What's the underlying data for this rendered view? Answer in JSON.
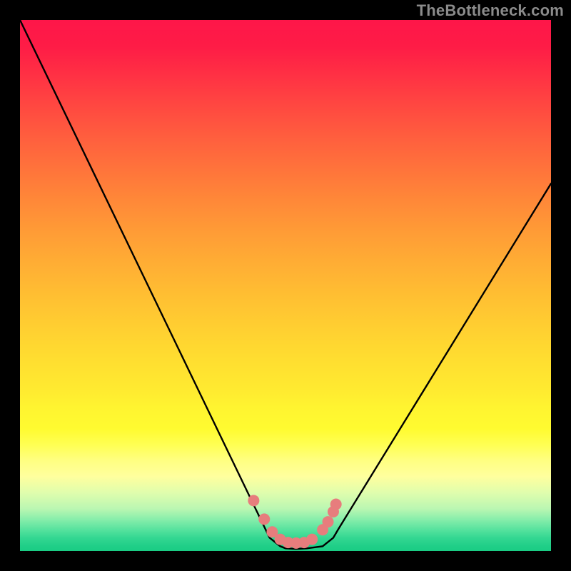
{
  "watermark": "TheBottleneck.com",
  "chart_data": {
    "type": "line",
    "title": "",
    "xlabel": "",
    "ylabel": "",
    "xlim": [
      0,
      100
    ],
    "ylim": [
      0,
      100
    ],
    "grid": false,
    "series": [
      {
        "name": "bottleneck-curve",
        "stroke": "#000000",
        "x": [
          0,
          4,
          8,
          12,
          16,
          20,
          24,
          28,
          32,
          36,
          40,
          44,
          47,
          49,
          50,
          52,
          54,
          57,
          59,
          60,
          64,
          68,
          72,
          76,
          80,
          84,
          88,
          92,
          96,
          100
        ],
        "values": [
          100,
          91.7,
          83.4,
          75.1,
          66.8,
          58.5,
          50.2,
          41.9,
          33.6,
          25.3,
          17,
          8.7,
          2.5,
          0.9,
          0.5,
          0.4,
          0.5,
          0.9,
          2.5,
          4.2,
          10.7,
          17.2,
          23.7,
          30.2,
          36.7,
          43.2,
          49.7,
          56.2,
          62.7,
          69.2
        ]
      },
      {
        "name": "bottom-markers",
        "type": "scatter",
        "color": "#e77d7d",
        "x": [
          44,
          46,
          47.5,
          49,
          50.5,
          52,
          53.5,
          55,
          57,
          58,
          59,
          59.5
        ],
        "values": [
          9.5,
          6.0,
          3.6,
          2.2,
          1.6,
          1.5,
          1.6,
          2.2,
          4.0,
          5.5,
          7.4,
          8.8
        ]
      }
    ],
    "background_gradient": {
      "type": "vertical",
      "stops": [
        {
          "pos": 0.0,
          "color": "#fe1649"
        },
        {
          "pos": 0.25,
          "color": "#ff6d3c"
        },
        {
          "pos": 0.5,
          "color": "#ffba32"
        },
        {
          "pos": 0.75,
          "color": "#fff830"
        },
        {
          "pos": 0.85,
          "color": "#ffff8f"
        },
        {
          "pos": 0.92,
          "color": "#b8f6b2"
        },
        {
          "pos": 1.0,
          "color": "#1acc84"
        }
      ]
    }
  }
}
